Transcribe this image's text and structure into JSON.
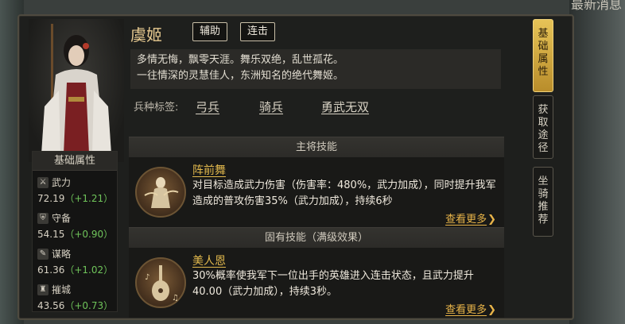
{
  "top_right_text": "最新消息",
  "hero": {
    "name": "虞姬",
    "tags": [
      "辅助",
      "连击"
    ],
    "description_lines": [
      "多情无悔，飘零天涯。舞乐双绝，乱世孤花。",
      "一往情深的灵慧佳人，东洲知名的绝代舞姬。"
    ],
    "troop_label": "兵种标签:",
    "troop_tags": [
      "弓兵",
      "骑兵",
      "勇武无双"
    ]
  },
  "stats": {
    "title": "基础属性",
    "items": [
      {
        "name": "武力",
        "icon": "sword-icon",
        "value": "72.19",
        "bonus": "（+1.21）"
      },
      {
        "name": "守备",
        "icon": "shield-icon",
        "value": "54.15",
        "bonus": "（+0.90）"
      },
      {
        "name": "谋略",
        "icon": "scroll-icon",
        "value": "61.36",
        "bonus": "（+1.02）"
      },
      {
        "name": "摧城",
        "icon": "siege-icon",
        "value": "43.56",
        "bonus": "（+0.73）"
      }
    ]
  },
  "skills": {
    "main_title": "主将技能",
    "main": {
      "name": "阵前舞",
      "icon": "dancer-icon",
      "desc": "对目标造成武力伤害（伤害率：480%，武力加成），同时提升我军造成的普攻伤害35%（武力加成），持续6秒",
      "more": "查看更多"
    },
    "inherent_title": "固有技能（满级效果）",
    "inherent": {
      "name": "美人恩",
      "icon": "pipa-icon",
      "desc": "30%概率使我军下一位出手的英雄进入连击状态，且武力提升40.00（武力加成），持续3秒。",
      "more": "查看更多"
    }
  },
  "side_tabs": [
    {
      "label": "基础属性",
      "active": true
    },
    {
      "label": "获取途径",
      "active": false
    },
    {
      "label": "坐骑推荐",
      "active": false
    }
  ],
  "colors": {
    "accent_gold": "#e2b94d",
    "bonus_green": "#6fc45a",
    "tab_active": "#e6c357"
  }
}
